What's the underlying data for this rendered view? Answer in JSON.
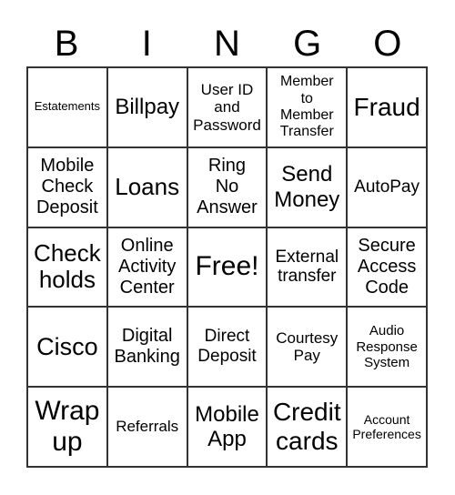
{
  "header": [
    "B",
    "I",
    "N",
    "G",
    "O"
  ],
  "cells": [
    "Estatements",
    "Billpay",
    "User ID\nand\nPassword",
    "Member\nto\nMember\nTransfer",
    "Fraud",
    "Mobile\nCheck\nDeposit",
    "Loans",
    "Ring\nNo\nAnswer",
    "Send\nMoney",
    "AutoPay",
    "Check\nholds",
    "Online\nActivity\nCenter",
    "Free!",
    "External\ntransfer",
    "Secure\nAccess\nCode",
    "Cisco",
    "Digital\nBanking",
    "Direct\nDeposit",
    "Courtesy\nPay",
    "Audio\nResponse\nSystem",
    "Wrap\nup",
    "Referrals",
    "Mobile\nApp",
    "Credit\ncards",
    "Account\nPreferences"
  ]
}
